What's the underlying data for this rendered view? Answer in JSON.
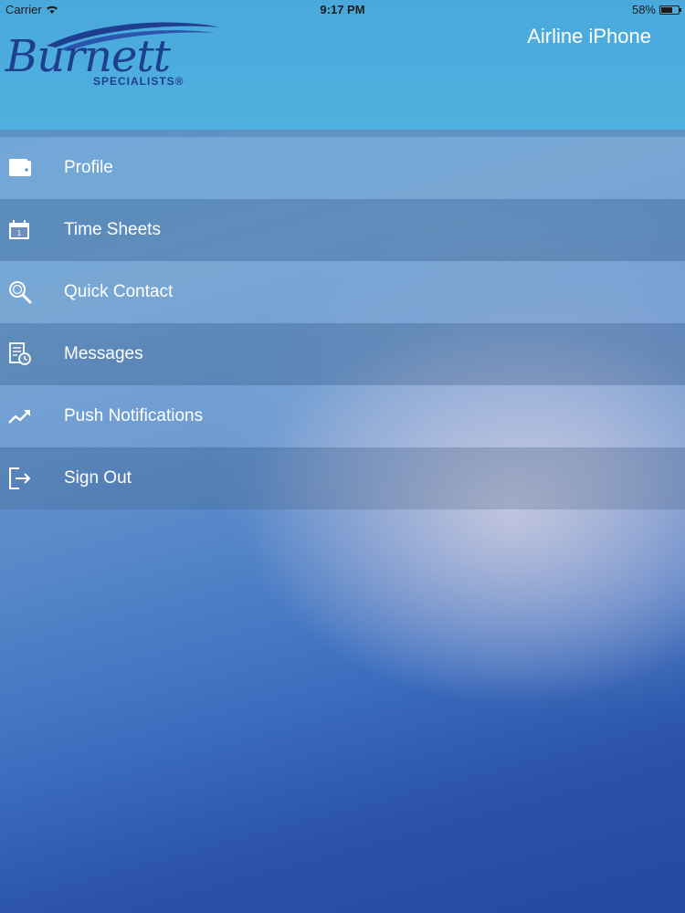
{
  "status_bar": {
    "carrier": "Carrier",
    "time": "9:17 PM",
    "battery": "58%",
    "battery_level": 0.58
  },
  "header": {
    "logo_name": "Burnett",
    "logo_sub": "SPECIALISTS®",
    "title": "Airline iPhone",
    "color": "#4aa9dc"
  },
  "menu": {
    "items": [
      {
        "label": "Profile",
        "icon": "wallet-icon"
      },
      {
        "label": "Time Sheets",
        "icon": "calendar-icon"
      },
      {
        "label": "Quick Contact",
        "icon": "search-icon"
      },
      {
        "label": "Messages",
        "icon": "document-clock-icon"
      },
      {
        "label": "Push Notifications",
        "icon": "trending-up-icon"
      },
      {
        "label": "Sign Out",
        "icon": "sign-out-icon"
      }
    ]
  }
}
